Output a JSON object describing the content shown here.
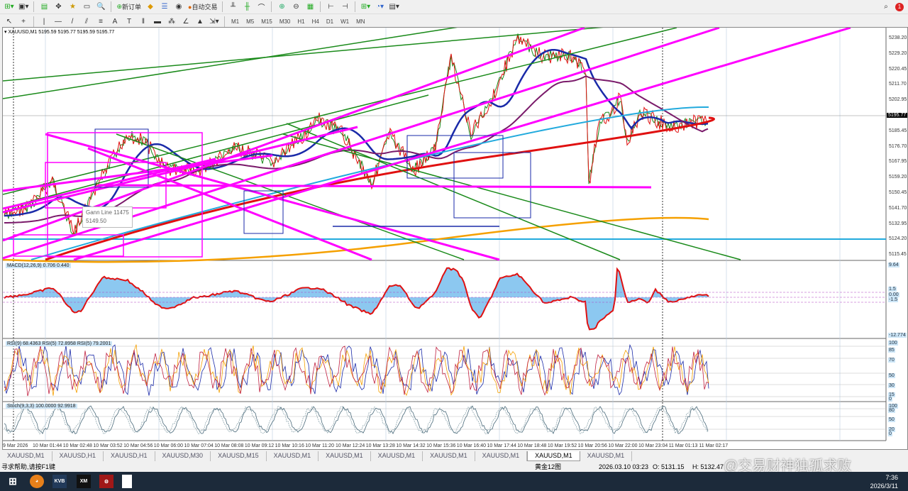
{
  "toolbar": {
    "new_order": "新订单",
    "auto_trading": "自动交易",
    "timeframes": [
      "M1",
      "M5",
      "M15",
      "M30",
      "H1",
      "H4",
      "D1",
      "W1",
      "MN"
    ]
  },
  "chart": {
    "header": "XAUUSD,M1  5195.59 5195.77 5195.59 5195.77",
    "current_price": "5195.77",
    "price_ticks": [
      "5238.20",
      "5229.20",
      "5220.45",
      "5211.70",
      "5202.95",
      "5194.20",
      "5185.45",
      "5176.70",
      "5167.95",
      "5159.20",
      "5150.45",
      "5141.70",
      "5132.95",
      "5124.20",
      "5115.45"
    ],
    "tooltip": {
      "title": "Gann Line 11475",
      "value": "5149.50"
    },
    "colors": {
      "magenta": "#ff00ff",
      "green": "#1a8a1a",
      "blue": "#1a2aa8",
      "red": "#e01010",
      "orange": "#f5a000",
      "cyan": "#22aadd",
      "purple": "#7a1a6a"
    }
  },
  "macd": {
    "label": "MACD(12,26,9) 0.706 0.440",
    "ticks": [
      "9.64",
      "1.5",
      "0.00",
      "-1.5",
      "-12.774"
    ]
  },
  "rsi": {
    "label": "RSI(9) 68.4363  RSI(5) 72.8958  RSI(5) 79.2001",
    "ticks": [
      "100",
      "85",
      "70",
      "50",
      "30",
      "15",
      "0"
    ]
  },
  "stoch": {
    "label": "Stoch(9,3,3) 100.0000 92.9918",
    "ticks": [
      "100",
      "80",
      "50",
      "20",
      "0"
    ]
  },
  "time_axis": [
    "9 Mar 2026",
    "10 Mar 01:44",
    "10 Mar 02:48",
    "10 Mar 03:52",
    "10 Mar 04:56",
    "10 Mar 06:00",
    "10 Mar 07:04",
    "10 Mar 08:08",
    "10 Mar 09:12",
    "10 Mar 10:16",
    "10 Mar 11:20",
    "10 Mar 12:24",
    "10 Mar 13:28",
    "10 Mar 14:32",
    "10 Mar 15:36",
    "10 Mar 16:40",
    "10 Mar 17:44",
    "10 Mar 18:48",
    "10 Mar 19:52",
    "10 Mar 20:56",
    "10 Mar 22:00",
    "10 Mar 23:04",
    "11 Mar 01:13",
    "11 Mar 02:17"
  ],
  "tabs": [
    "XAUUSD,M1",
    "XAUUSD,H1",
    "XAUUSD,H1",
    "XAUUSD,M30",
    "XAUUSD,M15",
    "XAUUSD,M1",
    "XAUUSD,M1",
    "XAUUSD,M1",
    "XAUUSD,M1",
    "XAUUSD,M1",
    "XAUUSD,M1",
    "XAUUSD,M1"
  ],
  "active_tab": 10,
  "status": {
    "help": "寻求帮助,请按F1键",
    "profile": "黄金12图",
    "datetime": "2026.03.10 03:23",
    "open": "O: 5131.15",
    "high": "H: 5132.47"
  },
  "watermark": "@交易财神独孤求败",
  "taskbar": {
    "time": "7:36",
    "date": "2026/3/11",
    "apps": [
      "KVB",
      "XM"
    ]
  }
}
